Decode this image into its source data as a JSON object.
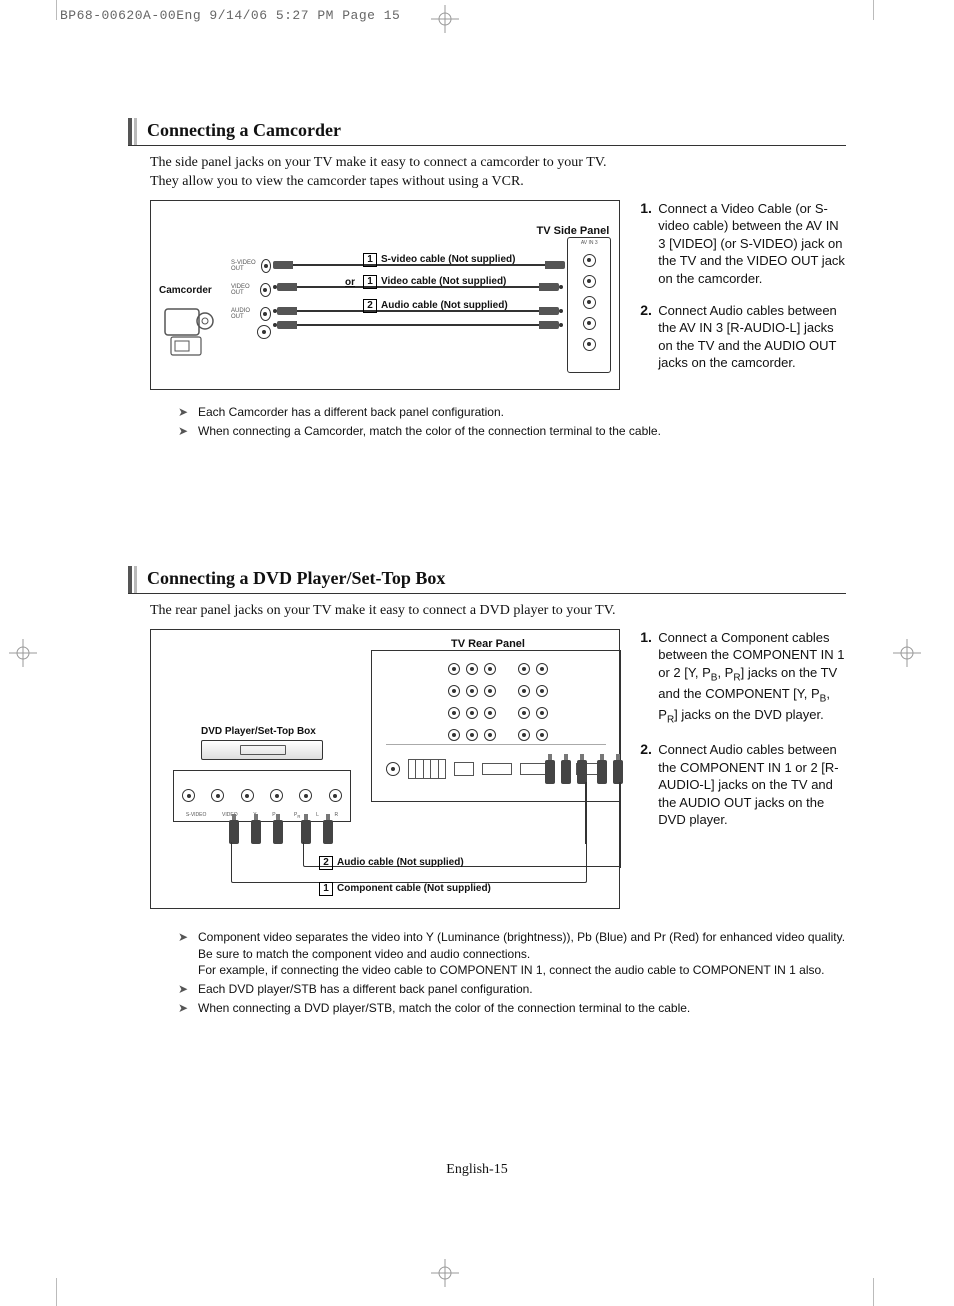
{
  "print_header": "BP68-00620A-00Eng  9/14/06  5:27 PM  Page 15",
  "page_footer": "English-15",
  "section1": {
    "title": "Connecting a Camcorder",
    "intro_line1": "The side panel jacks on your TV make it easy to connect a camcorder to your TV.",
    "intro_line2": "They allow you to view the camcorder tapes without using a VCR.",
    "diagram": {
      "camcorder_label": "Camcorder",
      "tv_panel_label": "TV Side Panel",
      "or_label": "or",
      "cable1_num": "1",
      "cable1_label": "S-video cable (Not supplied)",
      "cable2_num": "1",
      "cable2_label": "Video cable (Not supplied)",
      "cable3_num": "2",
      "cable3_label": "Audio cable (Not supplied)",
      "cam_ports": {
        "svideo": "S-VIDEO OUT",
        "video": "VIDEO OUT",
        "audio": "AUDIO OUT"
      }
    },
    "steps": [
      {
        "num": "1.",
        "text": "Connect a Video Cable (or S-video cable) between the AV IN 3 [VIDEO] (or S-VIDEO) jack on the TV and the VIDEO OUT jack on the camcorder."
      },
      {
        "num": "2.",
        "text": "Connect Audio cables between the AV IN 3 [R-AUDIO-L] jacks on the TV and the AUDIO OUT jacks on the camcorder."
      }
    ],
    "notes": [
      "Each Camcorder has a different back panel configuration.",
      "When connecting a Camcorder, match the color of the connection terminal to the cable."
    ]
  },
  "section2": {
    "title": "Connecting a DVD Player/Set-Top Box",
    "intro_line1": "The rear panel jacks on your TV make it easy to connect a DVD player to your TV.",
    "diagram": {
      "stb_label": "DVD Player/Set-Top Box",
      "tv_panel_label": "TV Rear Panel",
      "cable1_num": "1",
      "cable1_label": "Component cable (Not supplied)",
      "cable2_num": "2",
      "cable2_label": "Audio cable (Not supplied)"
    },
    "steps": [
      {
        "num": "1.",
        "html": "Connect a Component cables between the COMPONENT IN 1 or 2 [Y, P<span class='sub'>B</span>, P<span class='sub'>R</span>] jacks on the TV and the COMPONENT [Y, P<span class='sub'>B</span>, P<span class='sub'>R</span>] jacks on the DVD player."
      },
      {
        "num": "2.",
        "text": "Connect Audio cables between the COMPONENT IN 1 or 2 [R-AUDIO-L] jacks on the TV and the AUDIO OUT jacks on the DVD player."
      }
    ],
    "notes": [
      "Component video separates the video into Y (Luminance (brightness)), Pb (Blue) and Pr (Red) for enhanced video quality.\nBe sure to match the component video and audio connections.\nFor example, if connecting the video cable to COMPONENT IN 1, connect the audio cable to COMPONENT IN 1 also.",
      "Each DVD player/STB has a different back panel configuration.",
      "When connecting a DVD player/STB, match the color of the connection terminal to the cable."
    ]
  }
}
